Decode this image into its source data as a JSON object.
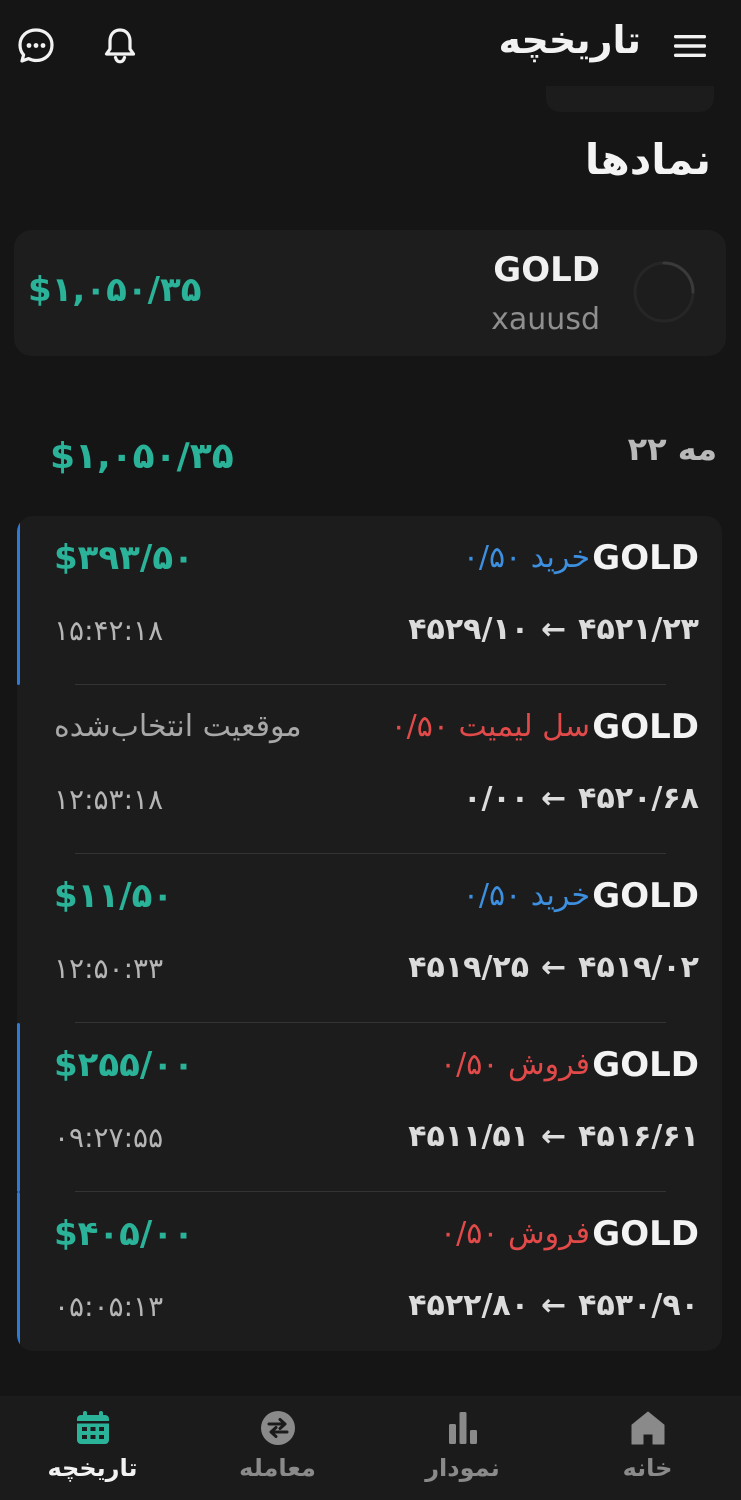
{
  "header": {
    "title": "تاریخچه"
  },
  "section": {
    "title": "نمادها"
  },
  "symbol_card": {
    "name": "GOLD",
    "code": "xauusd",
    "value": "$۱,۰۵۰/۳۵"
  },
  "day": {
    "label": "مه ۲۲",
    "total": "$۱,۰۵۰/۳۵"
  },
  "trades": [
    {
      "symbol": "GOLD",
      "side": "خرید ۰/۵۰",
      "side_type": "buy",
      "profit": "$۳۹۳/۵۰",
      "open_price": "۴۵۲۱/۲۳",
      "close_price": "۴۵۲۹/۱۰",
      "time": "۱۵:۴۲:۱۸",
      "highlighted": true
    },
    {
      "symbol": "GOLD",
      "side": "سل لیمیت ۰/۵۰",
      "side_type": "sell",
      "profit": "موقعیت انتخاب‌شده",
      "open_price": "۴۵۲۰/۶۸",
      "close_price": "۰/۰۰",
      "time": "۱۲:۵۳:۱۸",
      "highlighted": false
    },
    {
      "symbol": "GOLD",
      "side": "خرید ۰/۵۰",
      "side_type": "buy",
      "profit": "$۱۱/۵۰",
      "open_price": "۴۵۱۹/۰۲",
      "close_price": "۴۵۱۹/۲۵",
      "time": "۱۲:۵۰:۳۳",
      "highlighted": false
    },
    {
      "symbol": "GOLD",
      "side": "فروش ۰/۵۰",
      "side_type": "sell",
      "profit": "$۲۵۵/۰۰",
      "open_price": "۴۵۱۶/۶۱",
      "close_price": "۴۵۱۱/۵۱",
      "time": "۰۹:۲۷:۵۵",
      "highlighted": true
    },
    {
      "symbol": "GOLD",
      "side": "فروش ۰/۵۰",
      "side_type": "sell",
      "profit": "$۴۰۵/۰۰",
      "open_price": "۴۵۳۰/۹۰",
      "close_price": "۴۵۲۲/۸۰",
      "time": "۰۵:۰۵:۱۳",
      "highlighted": true
    }
  ],
  "arrow_glyph": "←",
  "nav": {
    "history": "تاریخچه",
    "trade": "معامله",
    "chart": "نمودار",
    "home": "خانه"
  },
  "colors": {
    "background": "#151515",
    "card": "#1d1d1d",
    "profit_green": "#2bb39a",
    "buy_blue": "#3d8fe0",
    "sell_red": "#e24a4a",
    "accent_border": "#2d7bd6"
  }
}
